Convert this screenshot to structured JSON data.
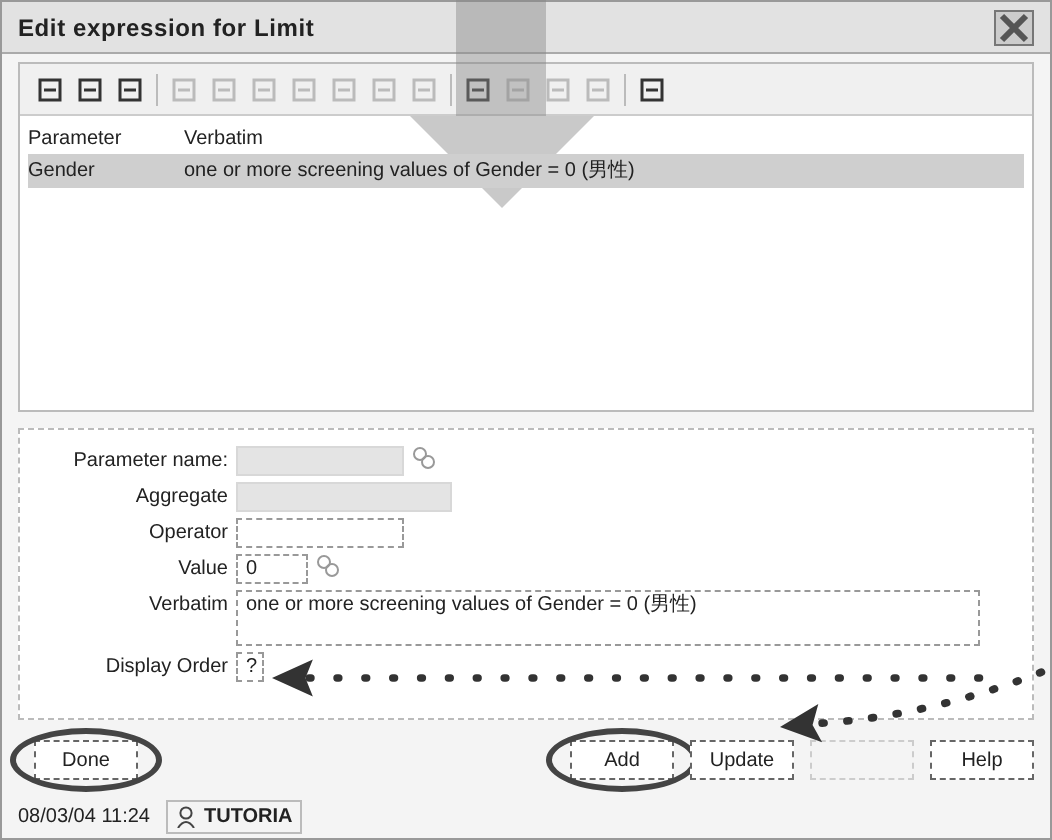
{
  "window": {
    "title": "Edit expression for Limit"
  },
  "toolbar": [
    {
      "disabled": false
    },
    {
      "disabled": false
    },
    {
      "disabled": false
    },
    {
      "disabled": true
    },
    {
      "disabled": true
    },
    {
      "disabled": true
    },
    {
      "disabled": true
    },
    {
      "disabled": true
    },
    {
      "disabled": true
    },
    {
      "disabled": true
    },
    {
      "disabled": false
    },
    {
      "disabled": true
    },
    {
      "disabled": true
    },
    {
      "disabled": true
    },
    {
      "disabled": false
    }
  ],
  "table": {
    "columns": [
      "Parameter",
      "Verbatim"
    ],
    "rows": [
      {
        "cells": [
          "Gender",
          "one or more screening values of Gender = 0 (男性)"
        ],
        "selected": true
      }
    ]
  },
  "form": {
    "fields": [
      {
        "label": "Parameter name:",
        "kind": "text",
        "disabled": true
      },
      {
        "label": "Aggregate",
        "kind": "combo",
        "disabled": true
      },
      {
        "label": "Operator",
        "kind": "text",
        "disabled": false
      },
      {
        "label": "Value",
        "kind": "value",
        "value": "0",
        "disabled": false
      },
      {
        "label": "Verbatim",
        "kind": "textarea",
        "value": "one or more screening values of Gender = 0 (男性)",
        "disabled": false
      },
      {
        "label": "Display Order",
        "kind": "text",
        "value": "?",
        "disabled": false
      }
    ]
  },
  "buttons": [
    {
      "label": "Done",
      "disabled": false,
      "circled": true
    },
    {
      "label": "Add",
      "disabled": false,
      "circled": true
    },
    {
      "label": "Update",
      "disabled": false,
      "circled": false
    },
    {
      "disabled": true,
      "circled": false
    },
    {
      "label": "Help",
      "disabled": false,
      "circled": false
    }
  ],
  "status_bar": {
    "time": "08/03/04 11:24",
    "user": "TUTORIA"
  }
}
